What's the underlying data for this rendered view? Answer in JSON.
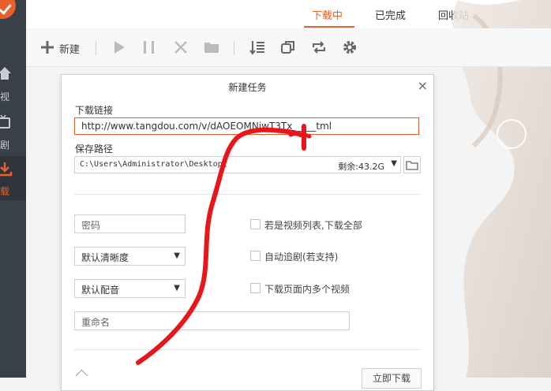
{
  "sidebar": {
    "items": [
      {
        "label": "视",
        "icon": "home-icon"
      },
      {
        "label": "剧",
        "icon": "tv-icon"
      },
      {
        "label": "载",
        "icon": "download-icon",
        "active": true
      }
    ]
  },
  "tabs": [
    {
      "label": "下载中",
      "active": true
    },
    {
      "label": "已完成"
    },
    {
      "label": "回收站"
    }
  ],
  "toolbar": {
    "new_label": "新建"
  },
  "dialog": {
    "title": "新建任务",
    "close": "×",
    "url_label": "下载链接",
    "url_value": "http://www.tangdou.com/v/dAOEOMNjwT3Tx_____tml",
    "path_label": "保存路径",
    "path_value": "C:\\Users\\Administrator\\Desktop\\",
    "free_space": "剩余:43.2G",
    "password_placeholder": "密码",
    "quality_select": "默认清晰度",
    "audio_select": "默认配音",
    "rename_placeholder": "重命名",
    "checkbox_playlist": "若是视频列表,下载全部",
    "checkbox_follow": "自动追剧(若支持)",
    "checkbox_multi": "下载页面内多个视频",
    "submit_label": "立即下载"
  },
  "colors": {
    "accent": "#e8602c",
    "sidebar_bg": "#3a4049",
    "annotation": "#e8151b"
  }
}
